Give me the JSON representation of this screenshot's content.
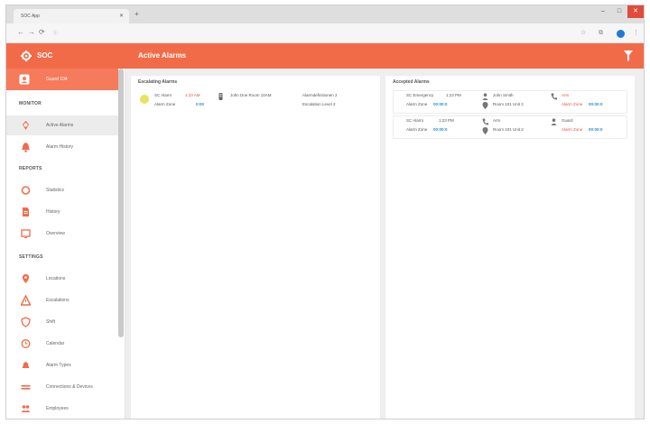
{
  "browser": {
    "tab_title": "SOC App",
    "url": "",
    "nav": {
      "back": "←",
      "forward": "→",
      "reload": "⟳"
    },
    "window": {
      "minimize": "–",
      "maximize": "□",
      "close": "✕"
    }
  },
  "app": {
    "brand": "SOC",
    "page_title": "Active Alarms",
    "accent_color": "#f26b49"
  },
  "sidebar": {
    "user": "Guard 104",
    "sections": {
      "monitor": "MONITOR",
      "reports": "REPORTS",
      "settings": "SETTINGS"
    },
    "items": [
      {
        "label": "Active Alarms",
        "icon": "alarm-icon",
        "active": true
      },
      {
        "label": "Alarm History",
        "icon": "bell-icon",
        "active": false
      },
      {
        "label": "Statistics",
        "icon": "chart-ring-icon",
        "active": false
      },
      {
        "label": "History",
        "icon": "document-icon",
        "active": false
      },
      {
        "label": "Overview",
        "icon": "screen-icon",
        "active": false
      },
      {
        "label": "Locations",
        "icon": "location-icon",
        "active": false
      },
      {
        "label": "Escalations",
        "icon": "warning-icon",
        "active": false
      },
      {
        "label": "Shift",
        "icon": "shield-icon",
        "active": false
      },
      {
        "label": "Calendar",
        "icon": "clock-icon",
        "active": false
      },
      {
        "label": "Alarm Types",
        "icon": "bell-type-icon",
        "active": false
      },
      {
        "label": "Connections & Devices",
        "icon": "devices-icon",
        "active": false
      },
      {
        "label": "Employees",
        "icon": "people-icon",
        "active": false
      }
    ]
  },
  "escalating": {
    "title": "Escalating Alarms",
    "alarm": {
      "name": "SC Alarm",
      "time": "1:23 AM",
      "sub": "Alarm Zone",
      "code": "0:00",
      "location": "John Doe Room 10AM",
      "detail1": "Alarmdefinitionen 2",
      "detail2": "Escalation Level 2"
    }
  },
  "accepted": {
    "title": "Accepted Alarms",
    "cards": [
      {
        "name": "SC Emergency",
        "time": "1:23 PM",
        "sub": "Alarm Zone",
        "code": "00:00:0",
        "person": "John Smith",
        "place": "Room 101 Unit 2",
        "phone": "Arm",
        "phone_sub": "Alarm Zone",
        "phone_code": "00:00:0"
      },
      {
        "name": "SC Alarm",
        "time": "1:23 PM",
        "sub": "Alarm Zone",
        "code": "00:00:0",
        "person": "Arm",
        "place": "Room 101 Unit 2",
        "phone": "Guard",
        "phone_sub": "Alarm Zone",
        "phone_code": "00:00:0"
      }
    ]
  }
}
